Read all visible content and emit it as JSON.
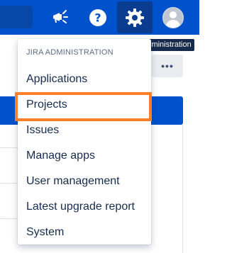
{
  "topbar": {
    "background": "#0052cc",
    "icons": {
      "announce": "megaphone-icon",
      "help": "help-icon",
      "settings": "gear-icon",
      "profile": "avatar-icon"
    }
  },
  "tooltip": {
    "text": "Administration"
  },
  "dropdown": {
    "heading": "JIRA ADMINISTRATION",
    "items": [
      {
        "label": "Applications"
      },
      {
        "label": "Projects"
      },
      {
        "label": "Issues"
      },
      {
        "label": "Manage apps"
      },
      {
        "label": "User management"
      },
      {
        "label": "Latest upgrade report"
      },
      {
        "label": "System"
      }
    ]
  },
  "background_page": {
    "more_button_label": "•••"
  },
  "colors": {
    "highlight": "#ff7f27",
    "menu_text": "#172b4d",
    "heading_text": "#5e6c84"
  }
}
